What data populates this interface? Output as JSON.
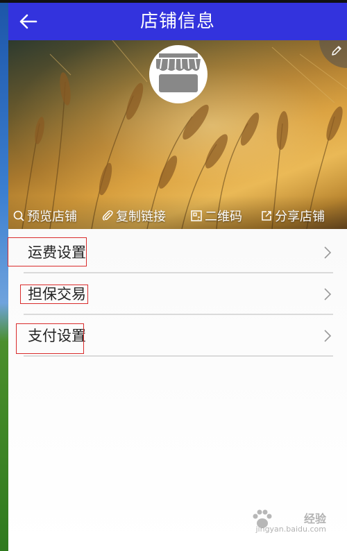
{
  "header": {
    "title": "店铺信息",
    "back_icon": "back-arrow-icon"
  },
  "banner": {
    "edit_icon": "pencil-icon",
    "avatar_icon": "storefront-icon",
    "actions": [
      {
        "label": "预览店铺",
        "icon": "search-icon"
      },
      {
        "label": "复制链接",
        "icon": "paperclip-icon"
      },
      {
        "label": "二维码",
        "icon": "qrcode-icon"
      },
      {
        "label": "分享店铺",
        "icon": "share-icon"
      }
    ]
  },
  "menu": {
    "items": [
      {
        "label": "运费设置",
        "icon": "chevron-right-icon"
      },
      {
        "label": "担保交易",
        "icon": "chevron-right-icon"
      },
      {
        "label": "支付设置",
        "icon": "chevron-right-icon"
      }
    ]
  },
  "watermark": {
    "text": "经验",
    "sub": "jingyan.baidu.com"
  },
  "colors": {
    "header": "#3333dd",
    "highlight_box": "#d92b2b",
    "divider": "#dadada"
  }
}
